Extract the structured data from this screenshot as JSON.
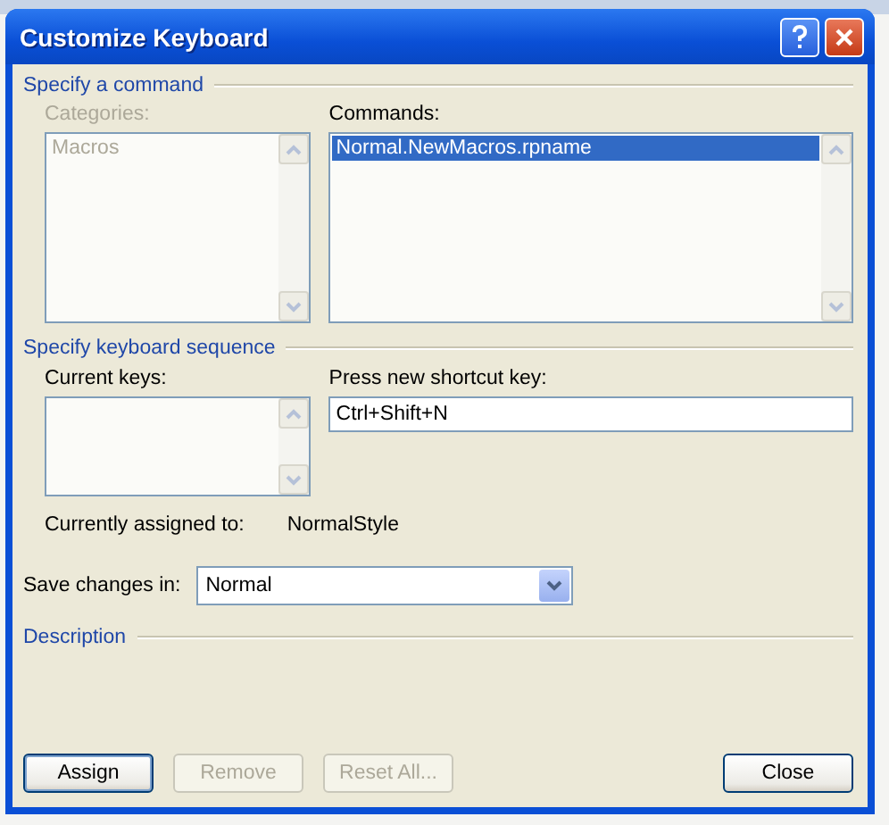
{
  "window": {
    "title": "Customize Keyboard"
  },
  "command_section": {
    "title": "Specify a command",
    "categories": {
      "label": "Categories:",
      "disabled": true,
      "items": [
        {
          "text": "Macros",
          "selected": false
        }
      ]
    },
    "commands": {
      "label": "Commands:",
      "disabled": false,
      "items": [
        {
          "text": "Normal.NewMacros.rpname",
          "selected": true
        }
      ]
    }
  },
  "keyboard_section": {
    "title": "Specify keyboard sequence",
    "current_keys": {
      "label": "Current keys:"
    },
    "new_shortcut": {
      "label": "Press new shortcut key:",
      "value": "Ctrl+Shift+N"
    },
    "currently_assigned": {
      "label": "Currently assigned to:",
      "value": "NormalStyle"
    }
  },
  "save_changes": {
    "label": "Save changes in:",
    "value": "Normal"
  },
  "description_section": {
    "title": "Description"
  },
  "buttons": [
    {
      "label": "Assign",
      "disabled": false,
      "focused": true
    },
    {
      "label": "Remove",
      "disabled": true,
      "focused": false
    },
    {
      "label": "Reset All...",
      "disabled": true,
      "focused": false
    },
    {
      "label": "Close",
      "disabled": false,
      "focused": false
    }
  ]
}
